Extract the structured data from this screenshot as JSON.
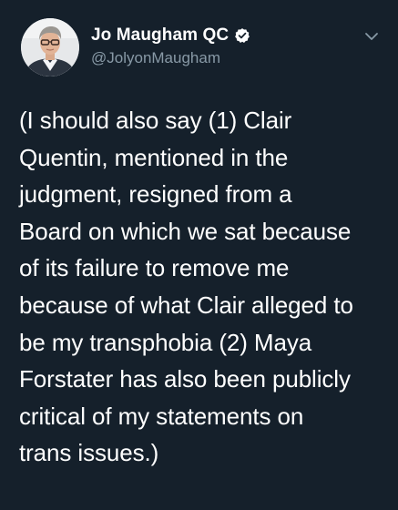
{
  "tweet": {
    "author": {
      "display_name": "Jo Maugham QC",
      "handle": "@JolyonMaugham",
      "verified": true,
      "avatar_icon": "profile-photo"
    },
    "menu_icon": "chevron-down-icon",
    "text_lines": [
      "(I should also say (1) Clair",
      "Quentin, mentioned in the",
      "judgment, resigned from a",
      "Board on which we sat because",
      "of its failure to remove me",
      "because of what Clair alleged to",
      "be my transphobia (2) Maya",
      "Forstater has also been publicly",
      "critical of my statements on",
      "trans issues.)"
    ]
  },
  "colors": {
    "background": "#15202b",
    "text_primary": "#ffffff",
    "text_secondary": "#8899a6",
    "accent": "#1da1f2"
  }
}
